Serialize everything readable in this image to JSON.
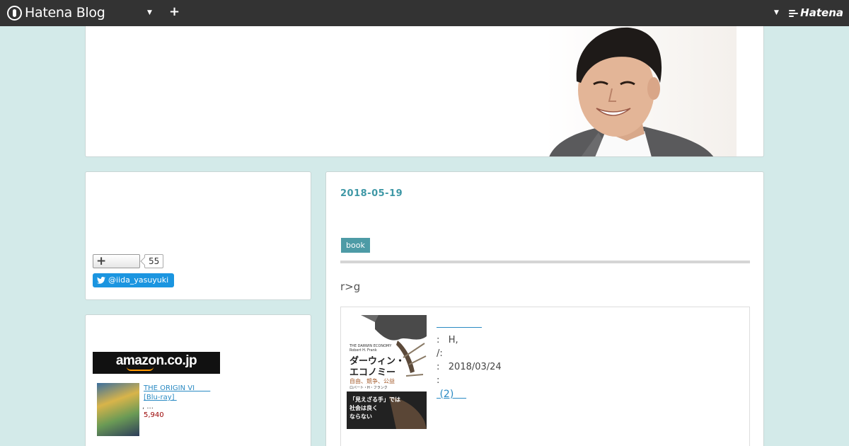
{
  "topbar": {
    "brand": "Hatena Blog",
    "add_label": "+",
    "hatena_label": "Hatena"
  },
  "sidebar": {
    "bookmark_count": "55",
    "twitter_handle": "@iida_yasuyuki",
    "amazon": {
      "banner": "amazon.co.jp",
      "product_title": "THE ORIGIN VI        [Blu-ray] ",
      "product_sub": ", ...",
      "product_price": "5,940"
    }
  },
  "entry": {
    "date": "2018-05-19",
    "tag": "book",
    "lead": "r>g",
    "book": {
      "line1": ":   H,",
      "line2": "/:",
      "line3": ":   2018/03/24",
      "line4": ":",
      "review_link": " (2)    ",
      "cover_title_en": "THE DARWIN ECONOMY",
      "cover_author_en": "Robert H. Frank",
      "cover_title_jp_1": "ダーウィン・",
      "cover_title_jp_2": "エコノミー",
      "cover_subtitle_jp": "自由、競争、公益",
      "cover_author_jp": "ロバート・H・フランク",
      "cover_band_1": "「見えざる手」では",
      "cover_band_2": "社会は良く",
      "cover_band_3": "ならない"
    }
  },
  "colors": {
    "page_bg": "#d3eae9",
    "topbar_bg": "#333333",
    "accent": "#3f98a6",
    "link": "#2a8ac3",
    "tag_bg": "#4d9ba6",
    "twitter": "#1b95e0"
  },
  "icons": {
    "brand": "hatena-blog-logo-icon",
    "menu": "chevron-down-icon",
    "add": "plus-icon",
    "bookmark": "hatena-bookmark-plus-icon",
    "twitter": "twitter-bird-icon"
  }
}
